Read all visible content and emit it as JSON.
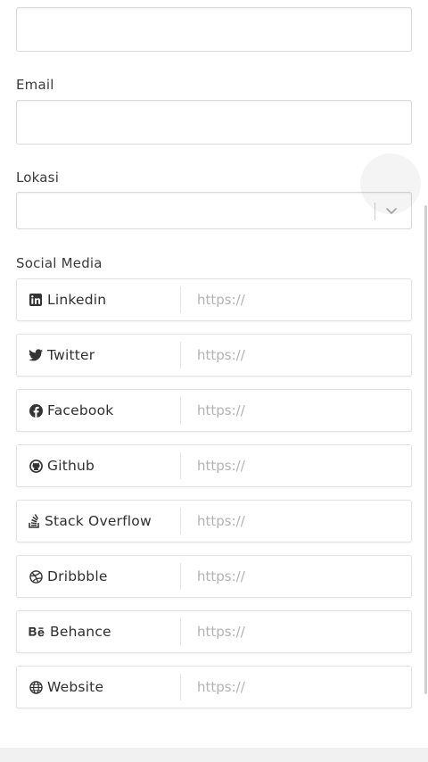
{
  "form": {
    "top_field": {
      "value": ""
    },
    "email": {
      "label": "Email",
      "value": ""
    },
    "location": {
      "label": "Lokasi",
      "value": "",
      "chevron_icon": "chevron-down-icon"
    },
    "social_media": {
      "label": "Social Media",
      "placeholder": "https://",
      "items": [
        {
          "name": "Linkedin",
          "icon": "linkedin-icon"
        },
        {
          "name": "Twitter",
          "icon": "twitter-icon"
        },
        {
          "name": "Facebook",
          "icon": "facebook-icon"
        },
        {
          "name": "Github",
          "icon": "github-icon"
        },
        {
          "name": "Stack Overflow",
          "icon": "stack-overflow-icon"
        },
        {
          "name": "Dribbble",
          "icon": "dribbble-icon"
        },
        {
          "name": "Behance",
          "icon": "behance-icon"
        },
        {
          "name": "Website",
          "icon": "globe-icon"
        }
      ]
    }
  },
  "colors": {
    "text": "#333333",
    "border": "#d9d9d9",
    "placeholder": "#b3b3b3",
    "background": "#ffffff"
  }
}
